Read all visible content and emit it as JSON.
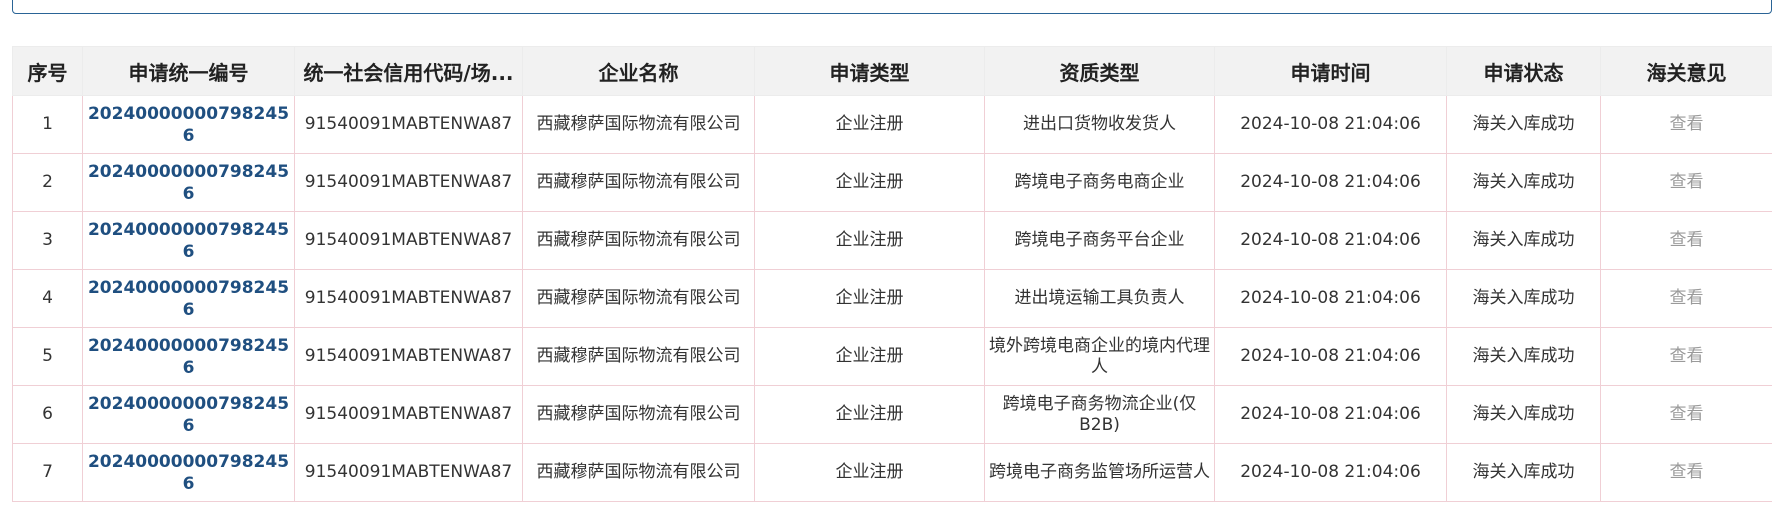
{
  "table": {
    "headers": [
      "序号",
      "申请统一编号",
      "统一社会信用代码/场...",
      "企业名称",
      "申请类型",
      "资质类型",
      "申请时间",
      "申请状态",
      "海关意见"
    ],
    "rows": [
      {
        "index": "1",
        "app_no": "202400000007982456",
        "credit_code": "91540091MABTENWA87",
        "company": "西藏穆萨国际物流有限公司",
        "app_type": "企业注册",
        "qual_type": "进出口货物收发货人",
        "time": "2024-10-08 21:04:06",
        "status": "海关入库成功",
        "opinion": "查看"
      },
      {
        "index": "2",
        "app_no": "202400000007982456",
        "credit_code": "91540091MABTENWA87",
        "company": "西藏穆萨国际物流有限公司",
        "app_type": "企业注册",
        "qual_type": "跨境电子商务电商企业",
        "time": "2024-10-08 21:04:06",
        "status": "海关入库成功",
        "opinion": "查看"
      },
      {
        "index": "3",
        "app_no": "202400000007982456",
        "credit_code": "91540091MABTENWA87",
        "company": "西藏穆萨国际物流有限公司",
        "app_type": "企业注册",
        "qual_type": "跨境电子商务平台企业",
        "time": "2024-10-08 21:04:06",
        "status": "海关入库成功",
        "opinion": "查看"
      },
      {
        "index": "4",
        "app_no": "202400000007982456",
        "credit_code": "91540091MABTENWA87",
        "company": "西藏穆萨国际物流有限公司",
        "app_type": "企业注册",
        "qual_type": "进出境运输工具负责人",
        "time": "2024-10-08 21:04:06",
        "status": "海关入库成功",
        "opinion": "查看"
      },
      {
        "index": "5",
        "app_no": "202400000007982456",
        "credit_code": "91540091MABTENWA87",
        "company": "西藏穆萨国际物流有限公司",
        "app_type": "企业注册",
        "qual_type": "境外跨境电商企业的境内代理人",
        "time": "2024-10-08 21:04:06",
        "status": "海关入库成功",
        "opinion": "查看"
      },
      {
        "index": "6",
        "app_no": "202400000007982456",
        "credit_code": "91540091MABTENWA87",
        "company": "西藏穆萨国际物流有限公司",
        "app_type": "企业注册",
        "qual_type": "跨境电子商务物流企业(仅B2B)",
        "time": "2024-10-08 21:04:06",
        "status": "海关入库成功",
        "opinion": "查看"
      },
      {
        "index": "7",
        "app_no": "202400000007982456",
        "credit_code": "91540091MABTENWA87",
        "company": "西藏穆萨国际物流有限公司",
        "app_type": "企业注册",
        "qual_type": "跨境电子商务监管场所运营人",
        "time": "2024-10-08 21:04:06",
        "status": "海关入库成功",
        "opinion": "查看"
      }
    ]
  }
}
